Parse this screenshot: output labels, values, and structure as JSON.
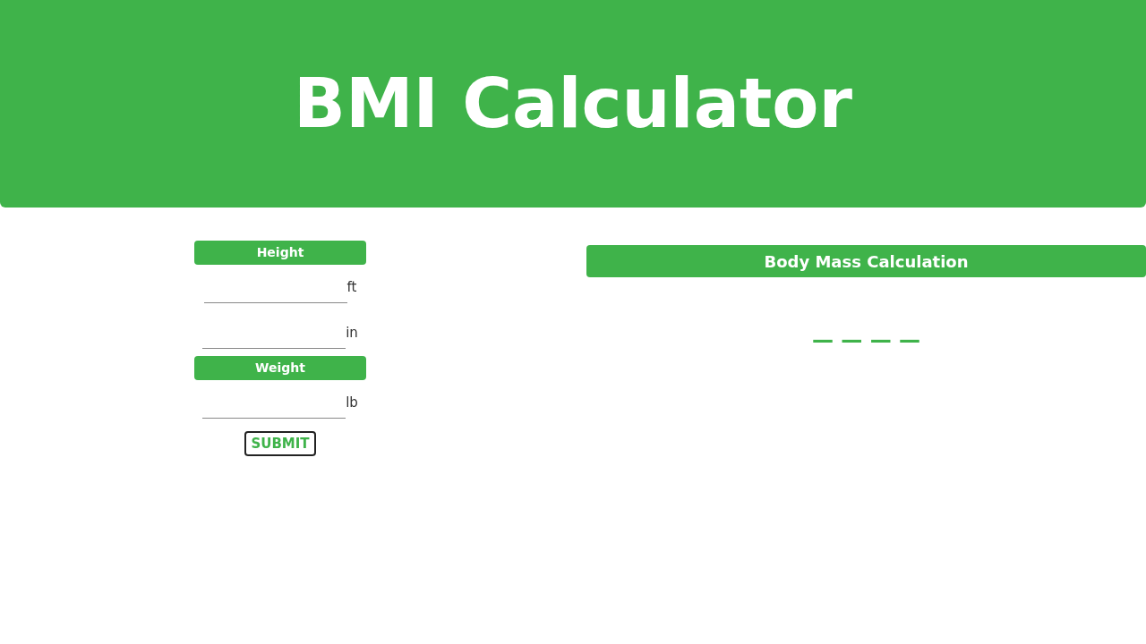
{
  "header": {
    "title": "BMI Calculator"
  },
  "form": {
    "sections": [
      {
        "label": "Height",
        "fields": [
          {
            "unit": "ft"
          },
          {
            "unit": "in"
          }
        ]
      },
      {
        "label": "Weight",
        "fields": [
          {
            "unit": "lb"
          }
        ]
      }
    ],
    "submit": "SUBMIT"
  },
  "result": {
    "title": "Body Mass Calculation",
    "value": "— — — —"
  }
}
